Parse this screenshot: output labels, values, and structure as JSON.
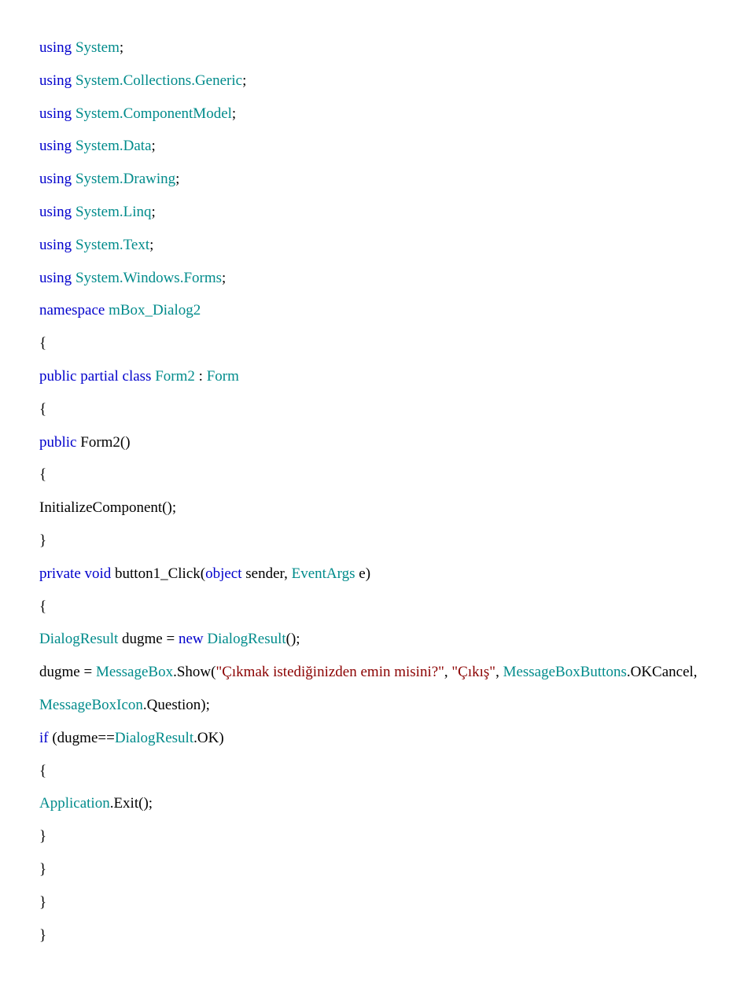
{
  "lines": [
    {
      "parts": [
        {
          "cls": "blue",
          "text": "using"
        },
        {
          "cls": "black",
          "text": " "
        },
        {
          "cls": "teal",
          "text": "System"
        },
        {
          "cls": "black",
          "text": ";"
        }
      ]
    },
    {
      "parts": [
        {
          "cls": "blue",
          "text": "using"
        },
        {
          "cls": "black",
          "text": " "
        },
        {
          "cls": "teal",
          "text": "System.Collections.Generic"
        },
        {
          "cls": "black",
          "text": ";"
        }
      ]
    },
    {
      "parts": [
        {
          "cls": "blue",
          "text": "using"
        },
        {
          "cls": "black",
          "text": " "
        },
        {
          "cls": "teal",
          "text": "System.ComponentModel"
        },
        {
          "cls": "black",
          "text": ";"
        }
      ]
    },
    {
      "parts": [
        {
          "cls": "blue",
          "text": "using"
        },
        {
          "cls": "black",
          "text": " "
        },
        {
          "cls": "teal",
          "text": "System.Data"
        },
        {
          "cls": "black",
          "text": ";"
        }
      ]
    },
    {
      "parts": [
        {
          "cls": "blue",
          "text": "using"
        },
        {
          "cls": "black",
          "text": " "
        },
        {
          "cls": "teal",
          "text": "System.Drawing"
        },
        {
          "cls": "black",
          "text": ";"
        }
      ]
    },
    {
      "parts": [
        {
          "cls": "blue",
          "text": "using"
        },
        {
          "cls": "black",
          "text": " "
        },
        {
          "cls": "teal",
          "text": "System.Linq"
        },
        {
          "cls": "black",
          "text": ";"
        }
      ]
    },
    {
      "parts": [
        {
          "cls": "blue",
          "text": "using"
        },
        {
          "cls": "black",
          "text": " "
        },
        {
          "cls": "teal",
          "text": "System.Text"
        },
        {
          "cls": "black",
          "text": ";"
        }
      ]
    },
    {
      "parts": [
        {
          "cls": "blue",
          "text": "using"
        },
        {
          "cls": "black",
          "text": " "
        },
        {
          "cls": "teal",
          "text": "System.Windows.Forms"
        },
        {
          "cls": "black",
          "text": ";"
        }
      ]
    },
    {
      "parts": [
        {
          "cls": "blue",
          "text": "namespace"
        },
        {
          "cls": "black",
          "text": " "
        },
        {
          "cls": "teal",
          "text": "mBox_Dialog2"
        }
      ]
    },
    {
      "parts": [
        {
          "cls": "black",
          "text": "{"
        }
      ]
    },
    {
      "parts": [
        {
          "cls": "blue",
          "text": "public partial class"
        },
        {
          "cls": "black",
          "text": " "
        },
        {
          "cls": "teal",
          "text": "Form2"
        },
        {
          "cls": "black",
          "text": " : "
        },
        {
          "cls": "teal",
          "text": "Form"
        }
      ]
    },
    {
      "parts": [
        {
          "cls": "black",
          "text": "{"
        }
      ]
    },
    {
      "parts": [
        {
          "cls": "blue",
          "text": "public"
        },
        {
          "cls": "black",
          "text": " Form2()"
        }
      ]
    },
    {
      "parts": [
        {
          "cls": "black",
          "text": "{"
        }
      ]
    },
    {
      "parts": [
        {
          "cls": "black",
          "text": "InitializeComponent();"
        }
      ]
    },
    {
      "parts": [
        {
          "cls": "black",
          "text": "}"
        }
      ]
    },
    {
      "parts": [
        {
          "cls": "blue",
          "text": "private void"
        },
        {
          "cls": "black",
          "text": " button1_Click("
        },
        {
          "cls": "blue",
          "text": "object"
        },
        {
          "cls": "black",
          "text": " sender, "
        },
        {
          "cls": "teal",
          "text": "EventArgs"
        },
        {
          "cls": "black",
          "text": " e)"
        }
      ]
    },
    {
      "parts": [
        {
          "cls": "black",
          "text": "{"
        }
      ]
    },
    {
      "parts": [
        {
          "cls": "teal",
          "text": "DialogResult"
        },
        {
          "cls": "black",
          "text": " dugme = "
        },
        {
          "cls": "blue",
          "text": "new"
        },
        {
          "cls": "black",
          "text": " "
        },
        {
          "cls": "teal",
          "text": "DialogResult"
        },
        {
          "cls": "black",
          "text": "();"
        }
      ]
    },
    {
      "parts": [
        {
          "cls": "black",
          "text": "dugme = "
        },
        {
          "cls": "teal",
          "text": "MessageBox"
        },
        {
          "cls": "black",
          "text": ".Show("
        },
        {
          "cls": "red",
          "text": "\"Çıkmak istediğinizden emin misini?\""
        },
        {
          "cls": "black",
          "text": ", "
        },
        {
          "cls": "red",
          "text": "\"Çıkış\""
        },
        {
          "cls": "black",
          "text": ", "
        },
        {
          "cls": "teal",
          "text": "MessageBoxButtons"
        },
        {
          "cls": "black",
          "text": ".OKCancel, "
        }
      ]
    },
    {
      "parts": [
        {
          "cls": "teal",
          "text": "MessageBoxIcon"
        },
        {
          "cls": "black",
          "text": ".Question);"
        }
      ]
    },
    {
      "parts": [
        {
          "cls": "blue",
          "text": "if"
        },
        {
          "cls": "black",
          "text": " (dugme=="
        },
        {
          "cls": "teal",
          "text": "DialogResult"
        },
        {
          "cls": "black",
          "text": ".OK)"
        }
      ]
    },
    {
      "parts": [
        {
          "cls": "black",
          "text": "{"
        }
      ]
    },
    {
      "parts": [
        {
          "cls": "teal",
          "text": "Application"
        },
        {
          "cls": "black",
          "text": ".Exit();"
        }
      ]
    },
    {
      "parts": [
        {
          "cls": "black",
          "text": "}"
        }
      ]
    },
    {
      "parts": [
        {
          "cls": "black",
          "text": "}"
        }
      ]
    },
    {
      "parts": [
        {
          "cls": "black",
          "text": "}"
        }
      ]
    },
    {
      "parts": [
        {
          "cls": "black",
          "text": "}"
        }
      ]
    }
  ]
}
